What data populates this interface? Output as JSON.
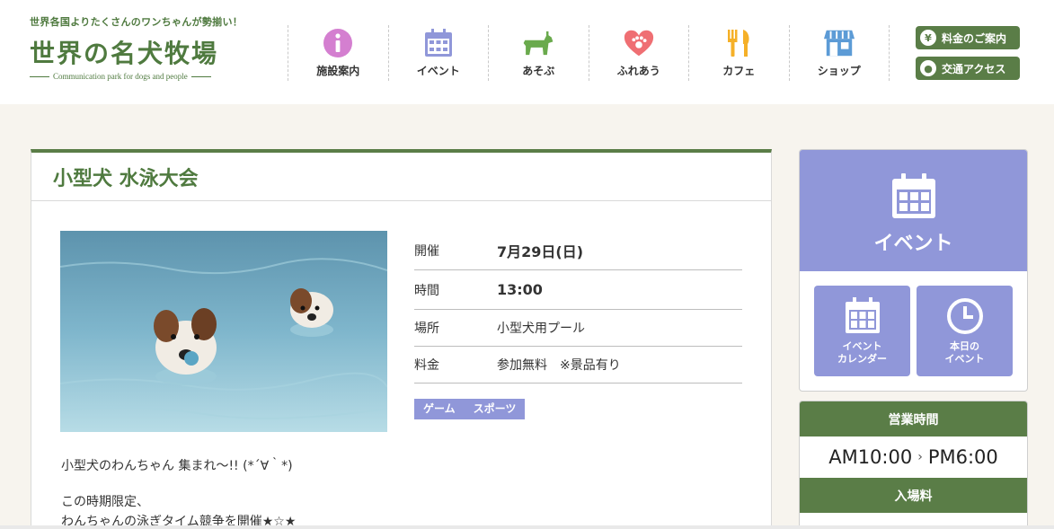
{
  "header": {
    "tagline": "世界各国よりたくさんのワンちゃんが勢揃い！",
    "brand": "世界の名犬牧場",
    "brand_sub": "Communication park for dogs and people",
    "nav": [
      {
        "label": "施設案内",
        "icon": "info-icon",
        "color": "#d47fd0"
      },
      {
        "label": "イベント",
        "icon": "calendar-icon",
        "color": "#9097d9"
      },
      {
        "label": "あそぶ",
        "icon": "dog-icon",
        "color": "#6aaa4d"
      },
      {
        "label": "ふれあう",
        "icon": "heart-paw-icon",
        "color": "#ef6f73"
      },
      {
        "label": "カフェ",
        "icon": "fork-knife-icon",
        "color": "#f5b028"
      },
      {
        "label": "ショップ",
        "icon": "shop-icon",
        "color": "#5c9bd6"
      }
    ],
    "side_buttons": [
      {
        "label": "料金のご案内",
        "icon": "yen-icon",
        "glyph": "¥"
      },
      {
        "label": "交通アクセス",
        "icon": "car-pin-icon",
        "glyph": "●"
      }
    ]
  },
  "article": {
    "title": "小型犬 水泳大会",
    "info": [
      {
        "key": "開催",
        "value": "7月29日(日)",
        "strong": true
      },
      {
        "key": "時間",
        "value": "13:00",
        "strong": true
      },
      {
        "key": "場所",
        "value": "小型犬用プール",
        "strong": false
      },
      {
        "key": "料金",
        "value": "参加無料　※景品有り",
        "strong": false
      }
    ],
    "tags": [
      "ゲーム",
      "スポーツ"
    ],
    "desc": [
      "小型犬のわんちゃん 集まれ〜!! (*´∀｀*)",
      "この時期限定、",
      "わんちゃんの泳ぎタイム競争を開催★☆★"
    ]
  },
  "sidebar": {
    "event_title": "イベント",
    "event_calendar": "イベント\nカレンダー",
    "event_today": "本日の\nイベント",
    "hours_title": "営業時間",
    "hours_open": "AM10:00",
    "hours_sep": "›",
    "hours_close": "PM6:00",
    "fee_title": "入場料"
  },
  "colors": {
    "green": "#5a7d47",
    "lavender": "#9097d9"
  }
}
